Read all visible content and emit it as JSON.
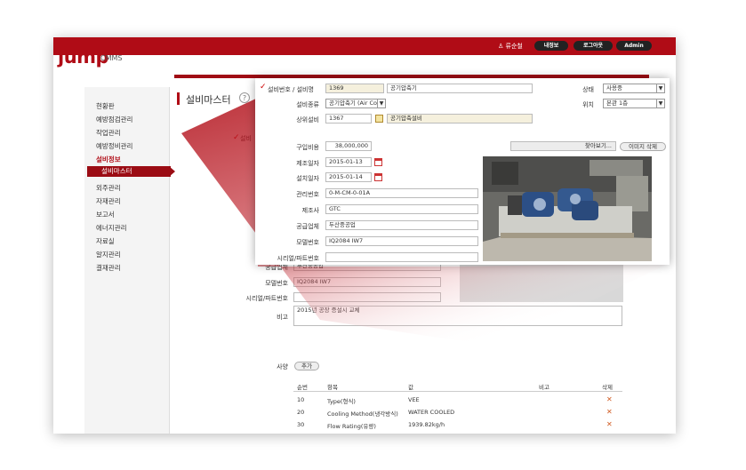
{
  "app": {
    "logo": "jump",
    "logo_sub": "CMMS"
  },
  "header": {
    "user": "류순철",
    "btn_myinfo": "내정보",
    "btn_logout": "로그아웃",
    "btn_admin": "Admin"
  },
  "sidebar": {
    "items": [
      {
        "label": "현황판"
      },
      {
        "label": "예방점검관리"
      },
      {
        "label": "작업관리"
      },
      {
        "label": "예방정비관리"
      },
      {
        "label": "설비정보"
      },
      {
        "label": "설비마스터"
      },
      {
        "label": "외주관리"
      },
      {
        "label": "자재관리"
      },
      {
        "label": "보고서"
      },
      {
        "label": "에너지관리"
      },
      {
        "label": "자료실"
      },
      {
        "label": "알지관리"
      },
      {
        "label": "결재관리"
      }
    ]
  },
  "page": {
    "title": "설비마스터",
    "help": "?"
  },
  "bg_form": {
    "row_label_top": "설비",
    "supplier_label": "공급업체",
    "supplier_value": "두산중공업",
    "model_label": "모델번호",
    "model_value": "IQ2084 IW7",
    "serial_label": "시리얼/파트번호",
    "serial_value": "",
    "note_label": "비고",
    "note_value": "2015년 공장 증설시 교체",
    "spec_label": "사양",
    "spec_btn": "추가",
    "table_headers": [
      "순번",
      "항목",
      "값",
      "비고",
      "삭제"
    ],
    "table_rows": [
      {
        "no": "10",
        "item": "Type(형식)",
        "value": "VEE",
        "note": "",
        "del": "✕"
      },
      {
        "no": "20",
        "item": "Cooling Method(냉각방식)",
        "value": "WATER COOLED",
        "note": "",
        "del": "✕"
      },
      {
        "no": "30",
        "item": "Flow Rating(유량)",
        "value": "1939.82kg/h",
        "note": "",
        "del": "✕"
      }
    ]
  },
  "popup": {
    "equip_no_label": "설비번호 / 설비명",
    "equip_no": "1369",
    "equip_name": "공기압축기",
    "status_label": "상태",
    "status_value": "사용중",
    "type_label": "설비종류",
    "type_value": "공기압축기 (Air Co",
    "location_label": "위치",
    "location_value": "본관 1층",
    "parent_label": "상위설비",
    "parent_no": "1367",
    "parent_name": "공기압축설비",
    "price_label": "구입비용",
    "price_value": "38,000,000",
    "browse_btn": "찾아보기...",
    "delete_img_btn": "이미지 삭제",
    "mfg_date_label": "제조일자",
    "mfg_date": "2015-01-13",
    "install_date_label": "설치일자",
    "install_date": "2015-01-14",
    "mgmt_no_label": "관리번호",
    "mgmt_no": "0-M-CM-0-01A",
    "maker_label": "제조사",
    "maker_value": "GTC",
    "supplier_label": "공급업체",
    "supplier_value": "두산중공업",
    "model_label": "모델번호",
    "model_value": "IQ2084 IW7",
    "serial_label": "시리얼/파트번호",
    "serial_value": ""
  },
  "colors": {
    "brand_red": "#b00c16",
    "dark_red": "#9b0c14"
  }
}
